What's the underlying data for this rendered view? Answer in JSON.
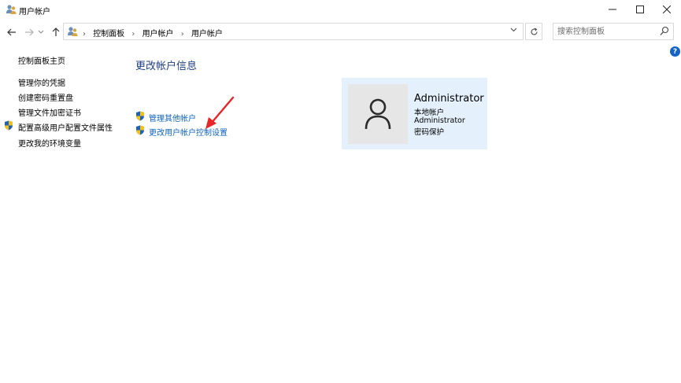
{
  "window": {
    "title": "用户帐户",
    "icon": "users-icon"
  },
  "nav": {
    "breadcrumb": [
      "控制面板",
      "用户帐户",
      "用户帐户"
    ],
    "search_placeholder": "搜索控制面板"
  },
  "left_pane": {
    "items": [
      {
        "label": "控制面板主页",
        "shield": false
      },
      {
        "label": "管理你的凭据",
        "shield": false
      },
      {
        "label": "创建密码重置盘",
        "shield": false
      },
      {
        "label": "管理文件加密证书",
        "shield": false
      },
      {
        "label": "配置高级用户配置文件属性",
        "shield": true
      },
      {
        "label": "更改我的环境变量",
        "shield": false
      }
    ]
  },
  "main": {
    "heading": "更改帐户信息",
    "links": [
      {
        "label": "管理其他帐户",
        "shield": true
      },
      {
        "label": "更改用户帐户控制设置",
        "shield": true
      }
    ]
  },
  "account": {
    "name": "Administrator",
    "details": [
      "本地帐户",
      "Administrator",
      "密码保护"
    ]
  },
  "colors": {
    "heading": "#1e3f84",
    "link": "#0d63c0",
    "card_bg": "#e4f0fb",
    "annotation_arrow": "#e8262a"
  }
}
